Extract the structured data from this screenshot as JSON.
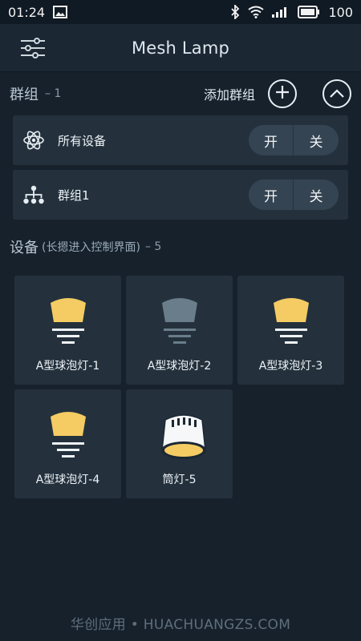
{
  "status_bar": {
    "time": "01:24",
    "battery": "100"
  },
  "app_bar": {
    "title": "Mesh Lamp"
  },
  "groups": {
    "label": "群组",
    "count": "– 1",
    "add_label": "添加群组",
    "rows": [
      {
        "name": "所有设备",
        "on_label": "开",
        "off_label": "关",
        "icon": "atom-icon"
      },
      {
        "name": "群组1",
        "on_label": "开",
        "off_label": "关",
        "icon": "hierarchy-icon"
      }
    ]
  },
  "devices": {
    "label": "设备",
    "hint": "(长摁进入控制界面)",
    "count": "– 5",
    "items": [
      {
        "name": "A型球泡灯-1",
        "icon": "bulb-icon",
        "state": "on"
      },
      {
        "name": "A型球泡灯-2",
        "icon": "bulb-icon",
        "state": "off"
      },
      {
        "name": "A型球泡灯-3",
        "icon": "bulb-icon",
        "state": "on"
      },
      {
        "name": "A型球泡灯-4",
        "icon": "bulb-icon",
        "state": "on"
      },
      {
        "name": "筒灯-5",
        "icon": "downlight-icon",
        "state": "on"
      }
    ]
  },
  "colors": {
    "lamp_on": "#f4cc63",
    "lamp_off": "#6a7d8a",
    "background": "#16212c",
    "card": "#24313d"
  },
  "watermark": "华创应用 • HUACHUANGZS.COM"
}
